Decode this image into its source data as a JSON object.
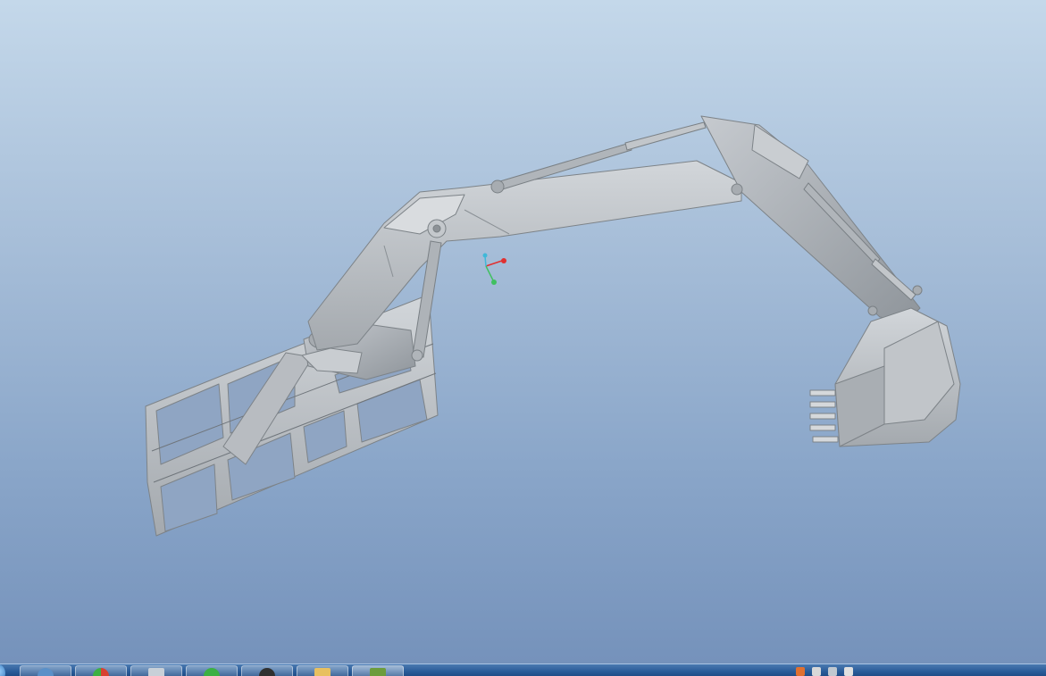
{
  "window": {
    "application": "3D CAD viewer"
  },
  "viewport": {
    "model": "excavator-arm-assembly",
    "background_top": "#c4d8ea",
    "background_bottom": "#7592bb",
    "model_color": "#b4b9be",
    "coordinate_axes": {
      "x_color": "#e03030",
      "y_color": "#40c060",
      "z_color": "#40b8d8"
    }
  },
  "taskbar": {
    "start_icon": "windows-start-orb-icon",
    "pinned": [
      {
        "icon": "explorer-icon",
        "color": "#5a90c8"
      },
      {
        "icon": "chrome-icon",
        "color": "#d84030"
      },
      {
        "icon": "document-icon",
        "color": "#c8d0d8"
      },
      {
        "icon": "360-browser-icon",
        "color": "#3cb043"
      },
      {
        "icon": "media-icon",
        "color": "#303030"
      },
      {
        "icon": "folder-icon",
        "color": "#e8c060"
      },
      {
        "icon": "cad-app-icon",
        "color": "#6c9c3c"
      }
    ],
    "tray_icons": [
      "flag-icon",
      "network-icon",
      "volume-icon",
      "clock-icon"
    ]
  }
}
